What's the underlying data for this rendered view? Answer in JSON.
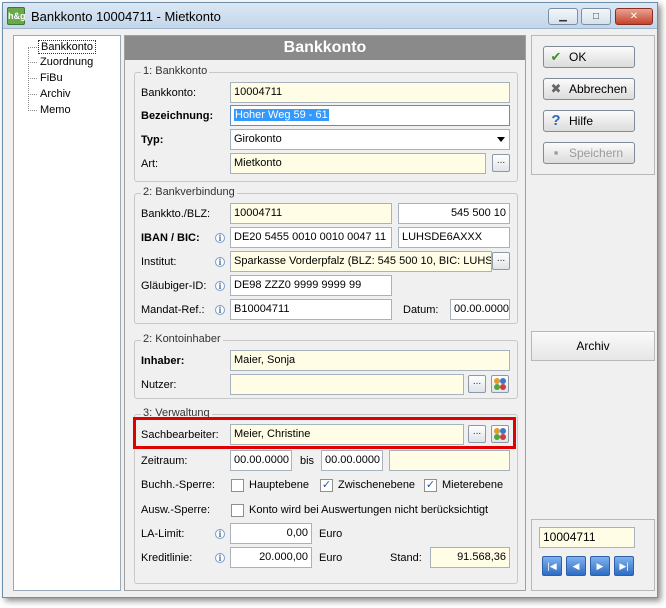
{
  "window": {
    "title": "Bankkonto 10004711 - Mietkonto",
    "icon_text": "h&g",
    "min_label": "▁",
    "max_label": "□",
    "close_label": "✕"
  },
  "tree": {
    "items": [
      "Bankkonto",
      "Zuordnung",
      "FiBu",
      "Archiv",
      "Memo"
    ]
  },
  "header": {
    "title": "Bankkonto"
  },
  "sec1": {
    "title": "1: Bankkonto",
    "bankkonto_label": "Bankkonto:",
    "bankkonto_value": "10004711",
    "bezeichnung_label": "Bezeichnung:",
    "bezeichnung_value": "Hoher Weg 59 - 61",
    "typ_label": "Typ:",
    "typ_value": "Girokonto",
    "art_label": "Art:",
    "art_value": "Mietkonto"
  },
  "sec2": {
    "title": "2: Bankverbindung",
    "bankkto_blz_label": "Bankkto./BLZ:",
    "bankkto_value": "10004711",
    "blz_value": "545 500 10",
    "iban_bic_label": "IBAN / BIC:",
    "iban_value": "DE20 5455 0010 0010 0047 11",
    "bic_value": "LUHSDE6AXXX",
    "institut_label": "Institut:",
    "institut_value": "Sparkasse Vorderpfalz  (BLZ: 545 500 10,  BIC: LUHS",
    "glaeubiger_label": "Gläubiger-ID:",
    "glaeubiger_value": "DE98 ZZZ0 9999 9999 99",
    "mandat_label": "Mandat-Ref.:",
    "mandat_value": "B10004711",
    "datum_label": "Datum:",
    "datum_value": "00.00.0000"
  },
  "sec3": {
    "title": "2: Kontoinhaber",
    "inhaber_label": "Inhaber:",
    "inhaber_value": "Maier, Sonja",
    "nutzer_label": "Nutzer:",
    "nutzer_value": ""
  },
  "sec4": {
    "title": "3: Verwaltung",
    "sachbearbeiter_label": "Sachbearbeiter:",
    "sachbearbeiter_value": "Meier, Christine",
    "zeitraum_label": "Zeitraum:",
    "zeitraum_from": "00.00.0000",
    "bis_label": "bis",
    "zeitraum_to": "00.00.0000",
    "buchh_label": "Buchh.-Sperre:",
    "hauptebene_label": "Hauptebene",
    "zwischenebene_label": "Zwischenebene",
    "mieterebene_label": "Mieterebene",
    "ausw_label": "Ausw.-Sperre:",
    "ausw_cb_label": "Konto wird bei Auswertungen nicht berücksichtigt",
    "la_limit_label": "LA-Limit:",
    "la_limit_value": "0,00",
    "euro1": "Euro",
    "kreditlinie_label": "Kreditlinie:",
    "kreditlinie_value": "20.000,00",
    "euro2": "Euro",
    "stand_label": "Stand:",
    "stand_value": "91.568,36"
  },
  "common": {
    "ellipsis": "...",
    "info": "i",
    "check": "✓"
  },
  "side": {
    "ok_label": "OK",
    "ok_icon": "✔",
    "abbrechen_label": "Abbrechen",
    "abbrechen_icon": "✖",
    "hilfe_label": "Hilfe",
    "hilfe_icon": "?",
    "speichern_label": "Speichern",
    "speichern_icon": "▪",
    "archiv_label": "Archiv"
  },
  "nav": {
    "record_value": "10004711",
    "first": "|◀",
    "prev": "◀",
    "next": "▶",
    "last": "▶|"
  }
}
